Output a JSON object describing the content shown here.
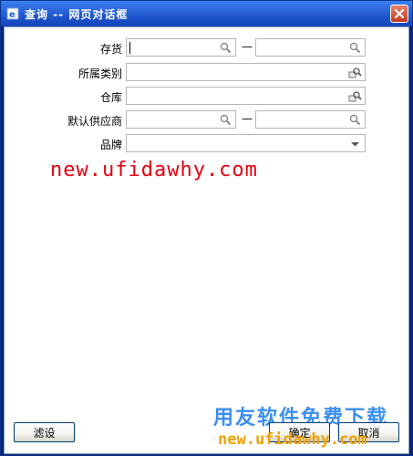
{
  "window": {
    "title": "查询 -- 网页对话框"
  },
  "form": {
    "inventory_label": "存货",
    "category_label": "所属类别",
    "warehouse_label": "仓库",
    "supplier_label": "默认供应商",
    "brand_label": "品牌",
    "range_separator": "—"
  },
  "watermarks": {
    "url_red": "new.ufidawhy.com",
    "brand_cn": "用友软件免费下载",
    "url_footer": "new.ufidawhy.com"
  },
  "buttons": {
    "filter_settings": "滤设",
    "ok": "确定",
    "cancel": "取消"
  },
  "colors": {
    "titlebar": "#2a64d8",
    "watermark_red": "#e40011",
    "watermark_blue": "#3b8ef0",
    "watermark_orange": "#f0a000"
  },
  "icons": {
    "title": "ie-page-icon",
    "close": "close-icon",
    "search": "search-icon",
    "reference": "reference-icon",
    "dropdown": "chevron-down-icon"
  }
}
